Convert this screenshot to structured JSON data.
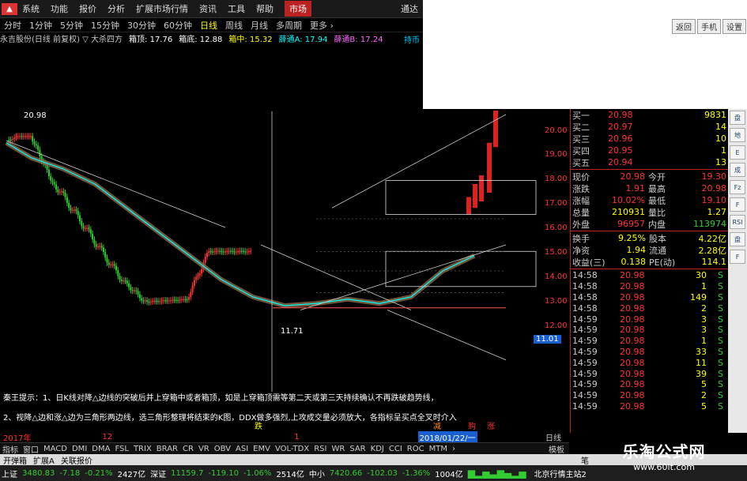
{
  "menu": {
    "items": [
      "系统",
      "功能",
      "报价",
      "分析",
      "扩展市场行情",
      "资讯",
      "工具",
      "帮助"
    ],
    "market": "市场",
    "right": "通达"
  },
  "periods": {
    "items": [
      "分时",
      "1分钟",
      "5分钟",
      "15分钟",
      "30分钟",
      "60分钟",
      "日线",
      "周线",
      "月线",
      "多周期",
      "更多 ›"
    ],
    "active_index": 6
  },
  "side_buttons": [
    "返回",
    "手机",
    "设置"
  ],
  "side_tab": "持币",
  "info": {
    "stock": "永吉股份(日线 前复权) ▽ 大杀四方",
    "items": [
      "箱顶: 17.76",
      "箱底: 12.88",
      "箱中: 15.32",
      "薛通A: 17.94",
      "薛通B: 17.24"
    ]
  },
  "chart_labels": {
    "high": "20.98",
    "low": "11.71",
    "tip1": "秦王提示：1、日K线对降△边线的突破后并上穿箱中或者箱顶，如是上穿箱顶需等第二天或第三天持续确认不再跌破趋势线，",
    "tip2": "2、视降△边和涨△边为三角形两边线，选三角形整理将结束的K图，DDX做多强烈,上攻成交量必须放大，各指标呈买点全叉时介入",
    "mark_die": "跌",
    "mark_jian": "减",
    "mark_mai": "购",
    "mark_zhang": "涨"
  },
  "price_axis": {
    "labels": [
      "20.00",
      "19.00",
      "18.00",
      "17.00",
      "16.00",
      "15.00",
      "14.00",
      "13.00",
      "12.00"
    ],
    "current": "11.01"
  },
  "timeline": {
    "year": "2017年",
    "month": "12",
    "month2": "1",
    "date_label": "2018/01/22/一",
    "period": "日线"
  },
  "quote": {
    "orders": [
      [
        "买一",
        "20.98",
        "9831"
      ],
      [
        "买二",
        "20.97",
        "14"
      ],
      [
        "买三",
        "20.96",
        "10"
      ],
      [
        "买四",
        "20.95",
        "1"
      ],
      [
        "买五",
        "20.94",
        "13"
      ]
    ],
    "stats": [
      [
        "现价",
        "20.98",
        "今开",
        "19.30"
      ],
      [
        "涨跌",
        "1.91",
        "最高",
        "20.98"
      ],
      [
        "涨幅",
        "10.02%",
        "最低",
        "19.10"
      ],
      [
        "总量",
        "210931",
        "量比",
        "1.27"
      ],
      [
        "外盘",
        "96957",
        "内盘",
        "113974"
      ]
    ],
    "fund": [
      [
        "换手",
        "9.25%",
        "股本",
        "4.22亿"
      ],
      [
        "净资",
        "1.94",
        "流通",
        "2.28亿"
      ],
      [
        "收益(三)",
        "0.138",
        "PE(动)",
        "114.1"
      ]
    ],
    "ticks": [
      [
        "14:58",
        "20.98",
        "30",
        "S"
      ],
      [
        "14:58",
        "20.98",
        "1",
        "S"
      ],
      [
        "14:58",
        "20.98",
        "149",
        "S"
      ],
      [
        "14:58",
        "20.98",
        "2",
        "S"
      ],
      [
        "14:59",
        "20.98",
        "3",
        "S"
      ],
      [
        "14:59",
        "20.98",
        "3",
        "S"
      ],
      [
        "14:59",
        "20.98",
        "1",
        "S"
      ],
      [
        "14:59",
        "20.98",
        "33",
        "S"
      ],
      [
        "14:59",
        "20.98",
        "11",
        "S"
      ],
      [
        "14:59",
        "20.98",
        "39",
        "S"
      ],
      [
        "14:59",
        "20.98",
        "5",
        "S"
      ],
      [
        "14:59",
        "20.98",
        "2",
        "S"
      ],
      [
        "14:59",
        "20.98",
        "5",
        "S"
      ]
    ]
  },
  "right_buttons": [
    "盘",
    "地",
    "E",
    "成",
    "Fz",
    "F",
    "RSI",
    "盘",
    "F"
  ],
  "indicators": {
    "items": [
      "指标",
      "窗口",
      "MACD",
      "DMI",
      "DMA",
      "FSL",
      "TRIX",
      "BRAR",
      "CR",
      "VR",
      "OBV",
      "ASI",
      "EMV",
      "VOL-TDX",
      "RSI",
      "WR",
      "SAR",
      "KDJ",
      "CCI",
      "ROC",
      "MTM",
      "›"
    ],
    "right": "模板"
  },
  "tabs": {
    "items": [
      "开弹箱",
      "扩展A",
      "关联报价"
    ],
    "right": "笔"
  },
  "status": {
    "sh_label": "上证",
    "sh_val": "3480.83",
    "sh_chg": "-7.18",
    "sh_pct": "-0.21%",
    "sh_amt": "2427亿",
    "sz_label": "深证",
    "sz_val": "11159.7",
    "sz_chg": "-119.10",
    "sz_pct": "-1.06%",
    "sz_amt": "2514亿",
    "zx_label": "中小",
    "zx_val": "7420.66",
    "zx_chg": "-102.03",
    "zx_pct": "-1.36%",
    "zx_amt": "1004亿",
    "right": "北京行情主站2"
  },
  "watermark": {
    "title": "乐淘公式网",
    "url": "www.60lt.com"
  },
  "colors": {
    "up": "#ff3333",
    "down": "#33cc33",
    "yellow": "#ffff00",
    "cyan": "#00ffff",
    "accent": "#b22222"
  }
}
